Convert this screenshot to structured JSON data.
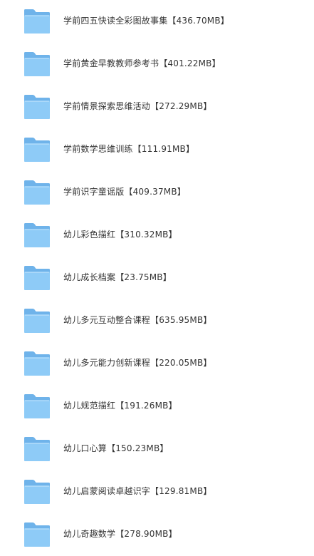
{
  "colors": {
    "folder_back": "#6fb3ea",
    "folder_front": "#8ecbf7",
    "text": "#333333",
    "background": "#ffffff"
  },
  "folders": [
    {
      "label": "学前四五快读全彩图故事集【436.70MB】",
      "icon": "folder-icon"
    },
    {
      "label": "学前黄金早教教师参考书【401.22MB】",
      "icon": "folder-icon"
    },
    {
      "label": "学前情景探索思维活动【272.29MB】",
      "icon": "folder-icon"
    },
    {
      "label": "学前数学思维训练【111.91MB】",
      "icon": "folder-icon"
    },
    {
      "label": "学前识字童谣版【409.37MB】",
      "icon": "folder-icon"
    },
    {
      "label": "幼儿彩色描红【310.32MB】",
      "icon": "folder-icon"
    },
    {
      "label": "幼儿成长档案【23.75MB】",
      "icon": "folder-icon"
    },
    {
      "label": "幼儿多元互动整合课程【635.95MB】",
      "icon": "folder-icon"
    },
    {
      "label": "幼儿多元能力创新课程【220.05MB】",
      "icon": "folder-icon"
    },
    {
      "label": "幼儿规范描红【191.26MB】",
      "icon": "folder-icon"
    },
    {
      "label": "幼儿口心算【150.23MB】",
      "icon": "folder-icon"
    },
    {
      "label": "幼儿启蒙阅读卓越识字【129.81MB】",
      "icon": "folder-icon"
    },
    {
      "label": "幼儿奇趣数学【278.90MB】",
      "icon": "folder-icon"
    }
  ]
}
